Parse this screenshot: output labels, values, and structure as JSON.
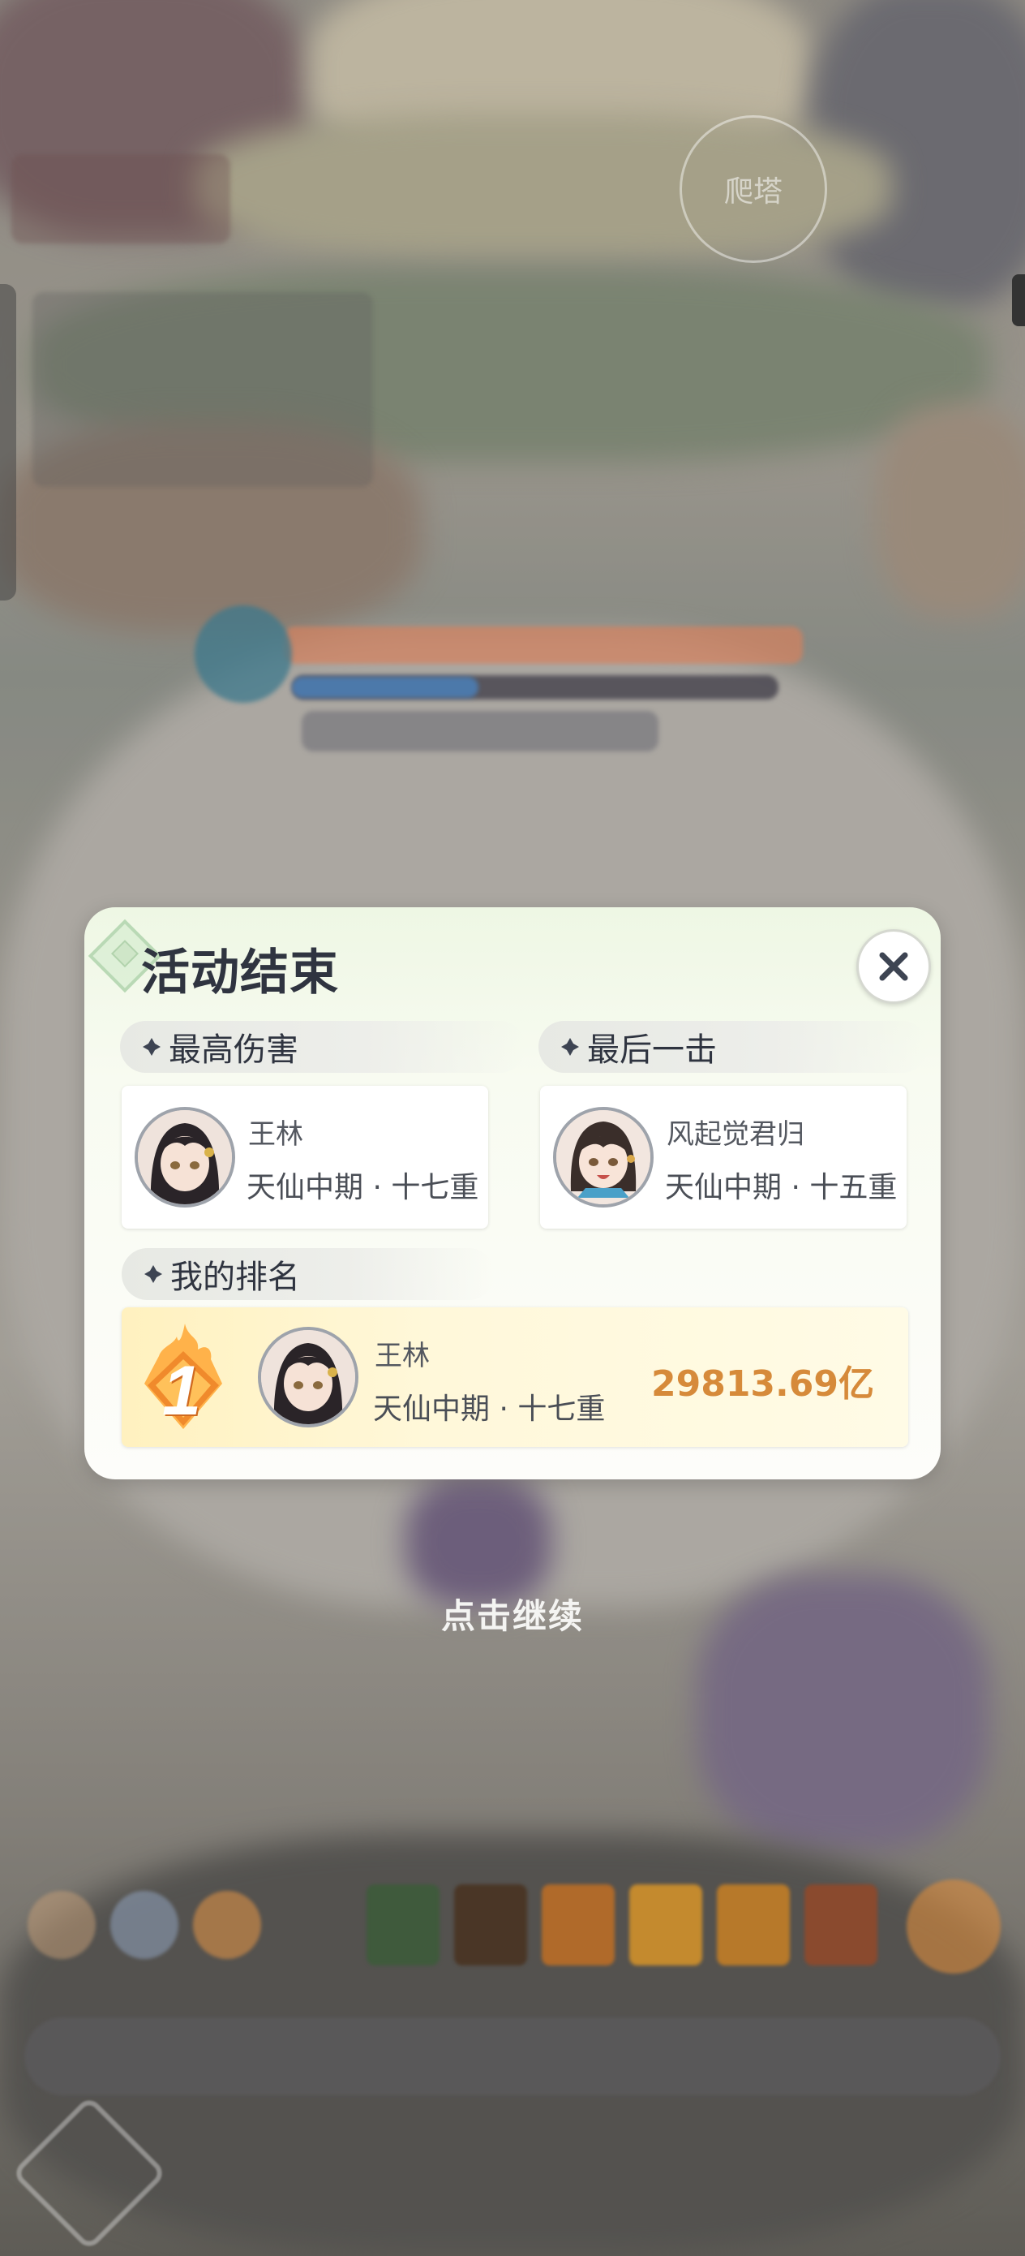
{
  "background": {
    "tower_button_label": "爬塔"
  },
  "dialog": {
    "title": "活动结束",
    "close_icon": "close-icon",
    "highest_damage": {
      "heading": "最高伤害",
      "player": {
        "name": "王林",
        "realm": "天仙中期 · 十七重"
      }
    },
    "last_hit": {
      "heading": "最后一击",
      "player": {
        "name": "风起觉君归",
        "realm": "天仙中期 · 十五重"
      }
    },
    "my_rank": {
      "heading": "我的排名",
      "rank": "1",
      "player": {
        "name": "王林",
        "realm": "天仙中期 · 十七重"
      },
      "damage": "29813.69亿"
    }
  },
  "continue_hint": "点击继续",
  "colors": {
    "score": "#d68a3a",
    "title": "#2f3440",
    "rank_badge": "#f3a53a"
  }
}
